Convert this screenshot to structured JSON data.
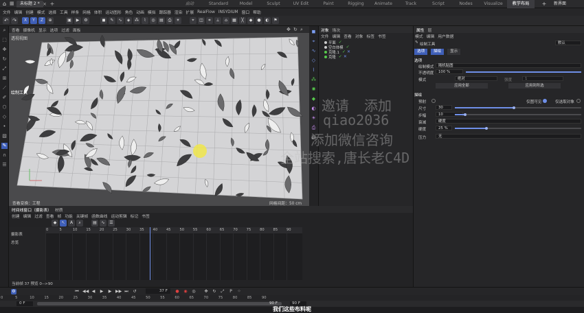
{
  "colors": {
    "accent": "#6f8fe8",
    "mode_blue": "#3f5fb8",
    "check": "#57c94c",
    "bg": "#1d1d1f"
  },
  "topbar": {
    "doc_tab": "未标题 2 *",
    "layout_label": "启动",
    "workspaces": [
      "Standard",
      "Model",
      "Sculpt",
      "UV Edit",
      "Paint",
      "Rigging",
      "Animate",
      "Track",
      "Script",
      "Nodes",
      "Visualize",
      "教学布局"
    ],
    "new_ui": "新界面"
  },
  "menubar": [
    "文件",
    "编辑",
    "创建",
    "模式",
    "选择",
    "工具",
    "样条",
    "网格",
    "体积",
    "运动图形",
    "角色",
    "动画",
    "模拟",
    "跟踪器",
    "渲染",
    "扩展",
    "RealFlow",
    "INSYDIUM",
    "窗口",
    "帮助"
  ],
  "iconbar": {
    "x": "X",
    "y": "Y",
    "z": "Z"
  },
  "viewport": {
    "menu": [
      "查看",
      "摄像机",
      "显示",
      "选项",
      "过滤",
      "面板"
    ],
    "name": "透视视图",
    "tool": "绘制工具",
    "status": "查看变换：工程",
    "grid": "网格间距：50 cm"
  },
  "object_manager": {
    "tabs": [
      "对象",
      "场次"
    ],
    "menu": [
      "文件",
      "编辑",
      "查看",
      "对象",
      "标签",
      "书签"
    ],
    "objects": [
      {
        "name": "平面",
        "color": "#dddddd"
      },
      {
        "name": "空白体模",
        "color": "#dddddd"
      },
      {
        "name": "克隆.1",
        "color": "#57c94c"
      },
      {
        "name": "克隆",
        "color": "#57c94c"
      }
    ]
  },
  "attributes": {
    "title": "属性",
    "tab2": "层",
    "menu": [
      "模式",
      "编辑",
      "用户数据"
    ],
    "tool_name": "绘制工具",
    "preset": "默认",
    "modes": [
      "选项",
      "描绘",
      "显示"
    ],
    "section_options": "选项",
    "paint_mode_label": "绘制模式",
    "paint_mode_value": "随机贴图",
    "opacity_label": "不透明度",
    "opacity_value": "100 %",
    "mode_label": "模式",
    "mode_value": "绝对",
    "strength_label": "强度",
    "strength_value": "1",
    "apply_all": "应用全部",
    "apply_selected": "应用到所选",
    "section_brush": "描绘",
    "preview_label": "预射",
    "visible_only": "仅图可见",
    "selected_only": "仅选取对象",
    "size_label": "尺寸",
    "size_value": "30",
    "step_label": "步幅",
    "step_value": "10",
    "falloff_label": "衰减",
    "falloff_value": "硬度",
    "hardness_label": "硬度",
    "hardness_value": "25 %",
    "pressure_label": "压力",
    "pressure_value": "无",
    "size_fraction": 0.47,
    "step_fraction": 0.08,
    "hardness_fraction": 0.25
  },
  "timeline": {
    "tabs": [
      "时间线窗口（摄影表）",
      "材质"
    ],
    "menu": [
      "创建",
      "编辑",
      "过滤",
      "查看",
      "帧",
      "功能",
      "关键帧",
      "函数曲线",
      "运动剪辑",
      "标记",
      "书签"
    ],
    "tracks": [
      "摄影表",
      "总览"
    ],
    "ruler": [
      "0",
      "5",
      "10",
      "15",
      "20",
      "25",
      "30",
      "35",
      "40",
      "45",
      "50",
      "55",
      "60",
      "65",
      "70",
      "75",
      "80",
      "85",
      "90"
    ],
    "status": "当前帧 37 预览 0-->90"
  },
  "transport": {
    "frame": "37 F"
  },
  "bottom_ruler": [
    "0",
    "5",
    "10",
    "15",
    "20",
    "25",
    "30",
    "35",
    "40",
    "45",
    "50",
    "55",
    "60",
    "65",
    "70",
    "75",
    "80",
    "85",
    "90"
  ],
  "range": {
    "start": "0 F",
    "end": "90 F",
    "end2": "90 F"
  },
  "subtitle": "我们这些布料呢",
  "watermark": [
    "添加",
    "邀请",
    "qiao2036",
    "添加微信咨询",
    "全站搜索,唐长老C4D"
  ]
}
